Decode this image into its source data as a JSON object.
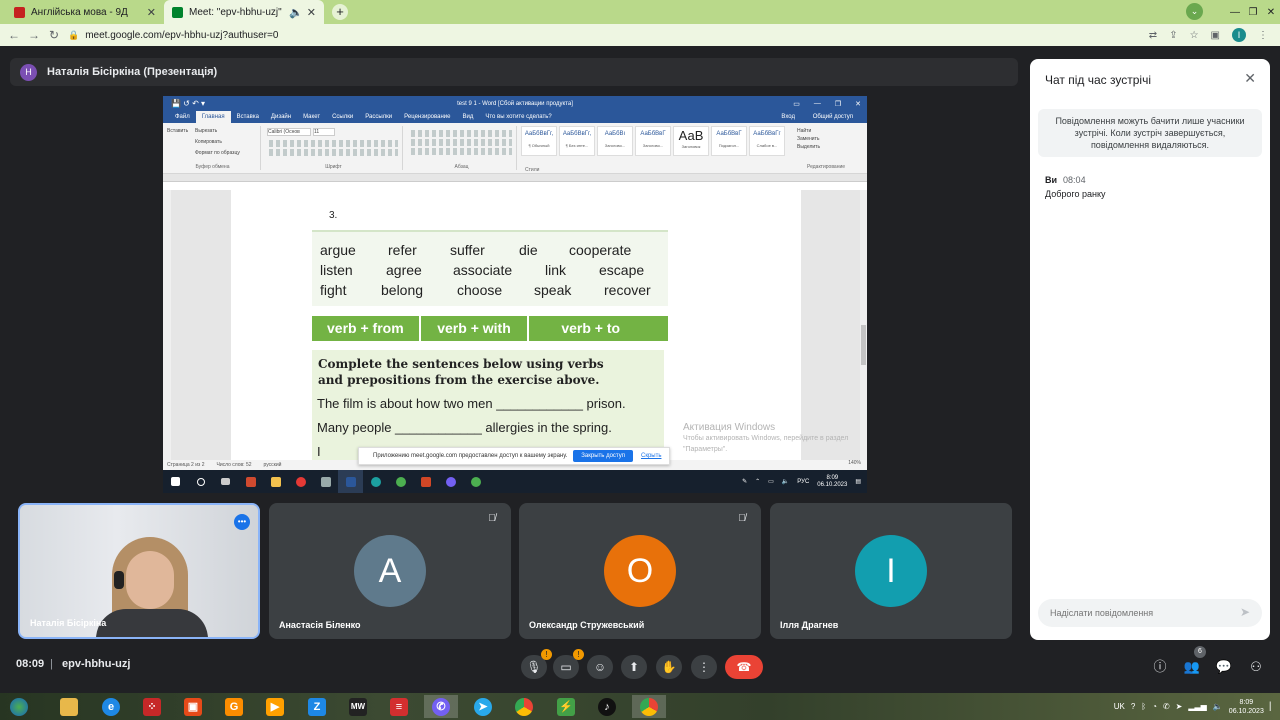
{
  "browser": {
    "tabs": [
      {
        "title": "Англійська мова - 9Д",
        "favicon_color": "#c5221f"
      },
      {
        "title": "Meet: \"epv-hbhu-uzj\"",
        "favicon_color": "#00832d"
      }
    ],
    "url": "meet.google.com/epv-hbhu-uzj?authuser=0",
    "profile_initial": "I"
  },
  "presenter": {
    "initial": "Н",
    "label": "Наталія Бісіркіна (Презентація)"
  },
  "word": {
    "title": "test 9 1 - Word [Сбой активации продукта]",
    "menu": [
      "Файл",
      "Главная",
      "Вставка",
      "Дизайн",
      "Макет",
      "Ссылки",
      "Рассылки",
      "Рецензирование",
      "Вид"
    ],
    "tell_me": "Что вы хотите сделать?",
    "signin": "Вход",
    "share": "Общий доступ",
    "clipboard": [
      "Вырезать",
      "Копировать",
      "Формат по образцу"
    ],
    "paste": "Вставить",
    "font_name": "Calibri (Основ",
    "font_size": "11",
    "group_labels": [
      "Буфер обмена",
      "Шрифт",
      "Абзац",
      "Стили",
      "Редактирование"
    ],
    "styles": [
      {
        "sample": "АаБбВвГг,",
        "label": "¶ Обычный"
      },
      {
        "sample": "АаБбВвГг,",
        "label": "¶ Без инте..."
      },
      {
        "sample": "АаБбВı",
        "label": "Заголово..."
      },
      {
        "sample": "АаБбВвГ",
        "label": "Заголово..."
      },
      {
        "sample": "АаВ",
        "label": "Заголовок"
      },
      {
        "sample": "АаБбВвГ",
        "label": "Подзагол..."
      },
      {
        "sample": "АаБбВвГг",
        "label": "Слабое в..."
      }
    ],
    "editing": [
      "Найти",
      "Заменить",
      "Выделить"
    ],
    "status": {
      "page": "Страница 2 из 2",
      "words": "Число слов: 52",
      "lang": "русский",
      "zoom": "140%"
    },
    "activation_title": "Активация Windows",
    "activation_sub": "Чтобы активировать Windows, перейдите в раздел \"Параметры\".",
    "share_banner": {
      "text": "Приложению meet.google.com предоставлен доступ к вашему экрану.",
      "stop": "Закрыть доступ",
      "hide": "Скрыть"
    },
    "tray": {
      "lang": "РУС",
      "time": "8:09",
      "date": "06.10.2023"
    }
  },
  "worksheet": {
    "number": "3.",
    "words_row1": [
      "argue",
      "refer",
      "suffer",
      "die",
      "cooperate"
    ],
    "words_row2": [
      "listen",
      "agree",
      "associate",
      "link",
      "escape"
    ],
    "words_row3": [
      "fight",
      "belong",
      "choose",
      "speak",
      "recover"
    ],
    "headers": [
      "verb + from",
      "verb + with",
      "verb + to"
    ],
    "instruction": "Complete the sentences below using verbs and prepositions from the exercise above.",
    "sentence1": "The film is about how two men ____________ prison.",
    "sentence2": "Many people ____________ allergies in the spring.",
    "sentence3": "I"
  },
  "participants": [
    {
      "name": "Наталія Бісіркіна",
      "self": true
    },
    {
      "name": "Анастасія Біленко",
      "initial": "А",
      "color": "#5f7a8c"
    },
    {
      "name": "Олександр Стружевський",
      "initial": "О",
      "color": "#e8710a"
    },
    {
      "name": "Ілля Драгнев",
      "initial": "I",
      "color": "#129eaf"
    }
  ],
  "chat": {
    "title": "Чат під час зустрічі",
    "note": "Повідомлення можуть бачити лише учасники зустрічі. Коли зустріч завершується, повідомлення видаляються.",
    "message": {
      "author": "Ви",
      "time": "08:04",
      "text": "Доброго ранку"
    },
    "input_placeholder": "Надіслати повідомлення"
  },
  "meeting": {
    "time": "08:09",
    "separator": "|",
    "code": "epv-hbhu-uzj",
    "people_count": "6"
  },
  "os": {
    "lang": "UK",
    "time": "8:09",
    "date": "06.10.2023"
  },
  "colors": {
    "end_call": "#ea4335",
    "accent": "#8ab4f8",
    "warning": "#f29900"
  }
}
